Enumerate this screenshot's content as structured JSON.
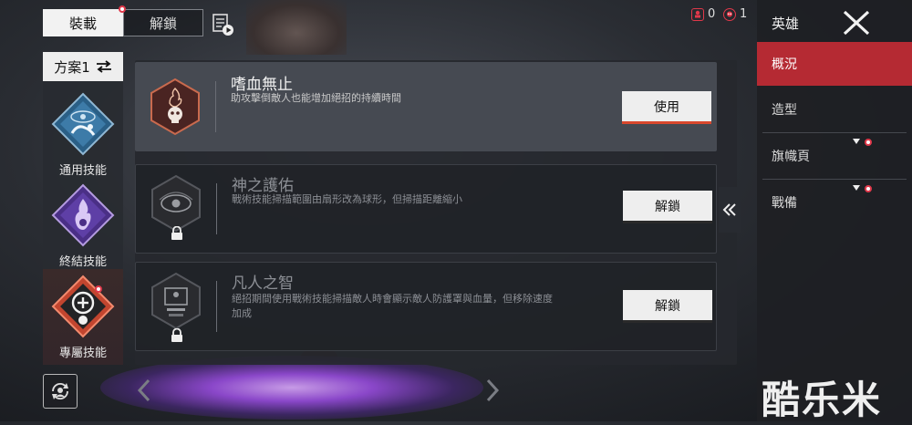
{
  "top_tabs": [
    {
      "label": "裝載",
      "active": true
    },
    {
      "label": "解鎖",
      "active": false
    }
  ],
  "counters": [
    {
      "icon": "legend-token-icon",
      "value": "0"
    },
    {
      "icon": "skull-badge-icon",
      "value": "1"
    }
  ],
  "loadout": {
    "name": "方案1",
    "slots": [
      {
        "label": "通用技能",
        "icon": "crawl-figure-icon"
      },
      {
        "label": "終結技能",
        "icon": "flame-figure-icon"
      },
      {
        "label": "專屬技能",
        "icon": "plus-skull-icon"
      }
    ]
  },
  "perks": [
    {
      "title": "嗜血無止",
      "desc": [
        "助攻擊倒敵人也能增加絕招的持續時間"
      ],
      "button": "使用",
      "icon": "bloodlust-skull-icon",
      "locked": false
    },
    {
      "title": "神之護佑",
      "desc": [
        "戰術技能掃描範圍由扇形改為球形，但掃描距離縮小"
      ],
      "button": "解鎖",
      "icon": "eye-emblem-icon",
      "locked": true
    },
    {
      "title": "凡人之智",
      "desc": [
        "絕招期間使用戰術技能掃描敵人時會顯示敵人防護罩與血量，但移除速度",
        "加成"
      ],
      "button": "解鎖",
      "icon": "monitor-emblem-icon",
      "locked": true
    }
  ],
  "right_nav": {
    "header": "英雄",
    "items": [
      {
        "label": "概況",
        "active": true
      },
      {
        "label": "造型",
        "active": false
      },
      {
        "label": "旗幟頁",
        "active": false
      },
      {
        "label": "戰備",
        "active": false
      }
    ]
  },
  "watermark": "酷乐米",
  "colors": {
    "accent_red": "#b52a33",
    "alert_red": "#e0384a",
    "orange_underline": "#d9482d"
  }
}
